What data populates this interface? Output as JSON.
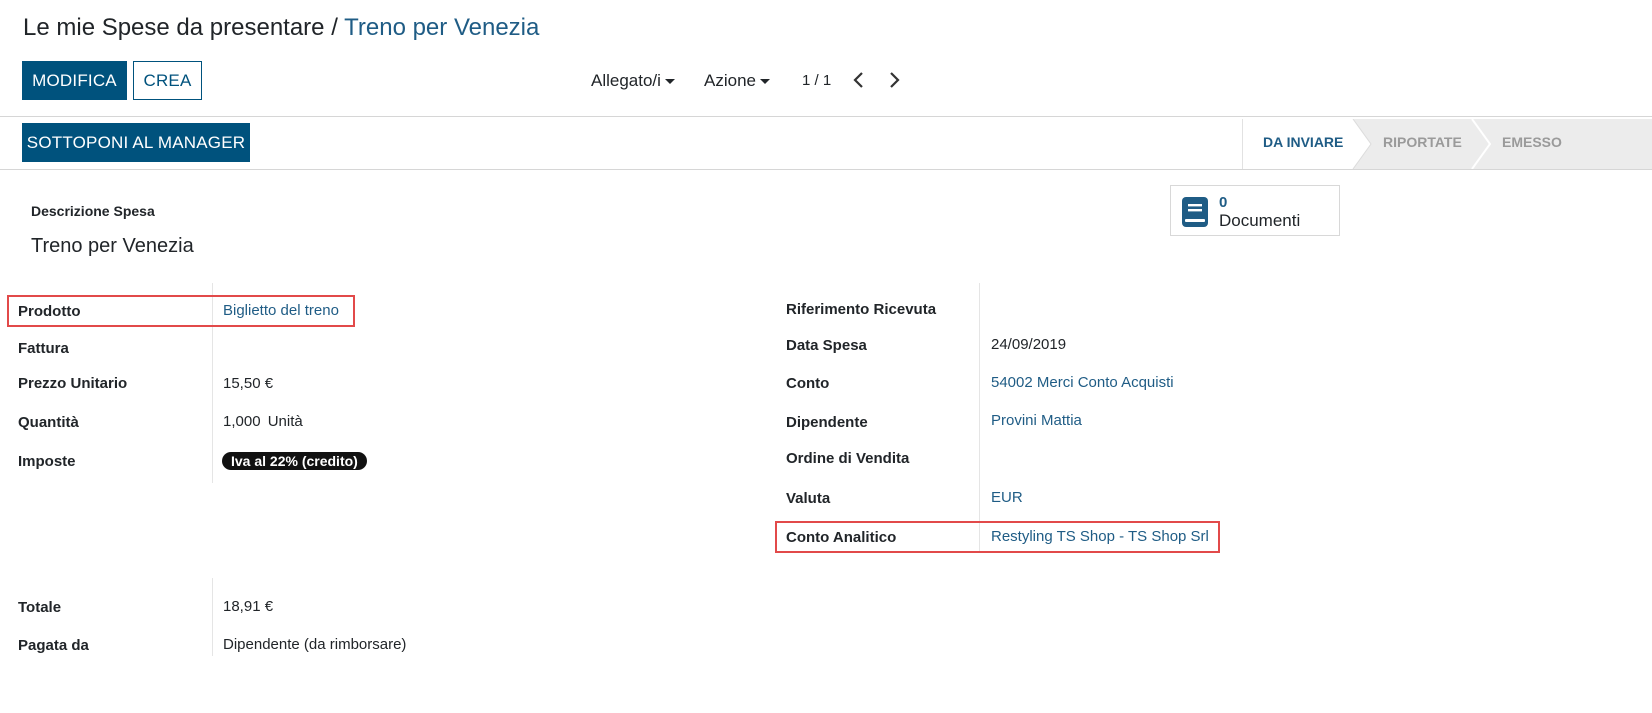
{
  "breadcrumb": {
    "parent": "Le mie Spese da presentare",
    "separator": "/",
    "current": "Treno per Venezia"
  },
  "toolbar": {
    "edit_label": "MODIFICA",
    "create_label": "CREA",
    "attachments_label": "Allegato/i",
    "action_label": "Azione",
    "pager": "1 / 1"
  },
  "statusbar": {
    "submit_label": "SOTTOPONI AL MANAGER",
    "stages": [
      "DA INVIARE",
      "RIPORTATE",
      "EMESSO"
    ],
    "active_stage": "DA INVIARE"
  },
  "documents": {
    "count": "0",
    "label": "Documenti"
  },
  "form": {
    "description_label": "Descrizione Spesa",
    "description_value": "Treno per Venezia",
    "left": {
      "product_label": "Prodotto",
      "product_value": "Biglietto del treno",
      "invoice_label": "Fattura",
      "unit_price_label": "Prezzo Unitario",
      "unit_price_value": "15,50 €",
      "quantity_label": "Quantità",
      "quantity_value": "1,000",
      "quantity_uom": "Unità",
      "taxes_label": "Imposte",
      "taxes_value": "Iva al 22% (credito)"
    },
    "right": {
      "receipt_ref_label": "Riferimento Ricevuta",
      "date_label": "Data Spesa",
      "date_value": "24/09/2019",
      "account_label": "Conto",
      "account_value": "54002 Merci Conto Acquisti",
      "employee_label": "Dipendente",
      "employee_value": "Provini Mattia",
      "sale_order_label": "Ordine di Vendita",
      "currency_label": "Valuta",
      "currency_value": "EUR",
      "analytic_label": "Conto Analitico",
      "analytic_value": "Restyling TS Shop - TS Shop Srl"
    },
    "bottom": {
      "total_label": "Totale",
      "total_value": "18,91 €",
      "paid_by_label": "Pagata da",
      "paid_by_value": "Dipendente (da rimborsare)"
    }
  },
  "colors": {
    "primary": "#00527d",
    "link": "#1f5c85",
    "highlight": "#e24a4a"
  }
}
